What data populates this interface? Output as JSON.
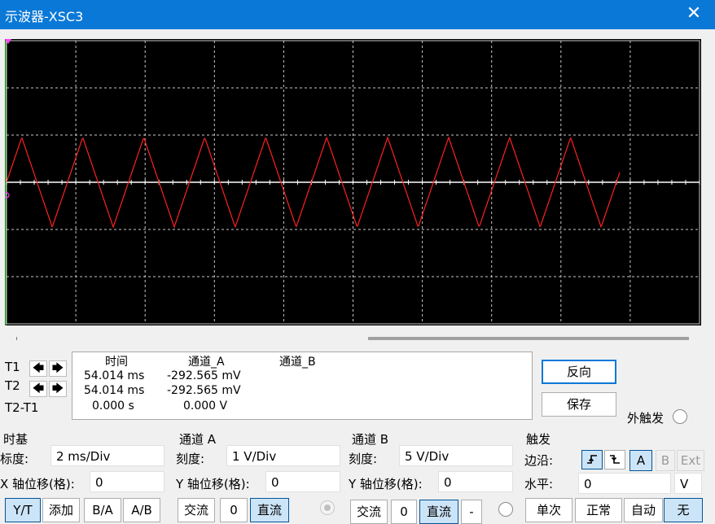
{
  "window": {
    "title": "示波器-XSC3",
    "close_icon": "close-icon"
  },
  "trace": {
    "color": "#ff2020",
    "axis_color": "#ffffff",
    "grid_color": "#c8c8c8",
    "cursor_t1_color": "#ff40ff",
    "cursor_t2_color": "#40ff40"
  },
  "cursors": {
    "t1_label": "T1",
    "t2_label": "T2",
    "diff_label": "T2-T1",
    "left_arrow": "🡄",
    "right_arrow": "🡆"
  },
  "readout": {
    "headers": {
      "time": "时间",
      "channel_a": "通道_A",
      "channel_b": "通道_B"
    },
    "rows": [
      {
        "time": "54.014 ms",
        "a": "-292.565 mV",
        "b": ""
      },
      {
        "time": "54.014 ms",
        "a": "-292.565 mV",
        "b": ""
      },
      {
        "time": "0.000 s",
        "a": "0.000 V",
        "b": ""
      }
    ]
  },
  "actions": {
    "reverse": "反向",
    "save": "保存",
    "ext_trigger": "外触发"
  },
  "timebase": {
    "section": "时基",
    "scale_label": "标度:",
    "scale_value": "2 ms/Div",
    "xpos_label": "X 轴位移(格):",
    "xpos_value": "0",
    "mode_buttons": [
      "Y/T",
      "添加",
      "B/A",
      "A/B"
    ],
    "active_mode": "Y/T"
  },
  "channel_a": {
    "section": "通道 A",
    "scale_label": "刻度:",
    "scale_value": "1  V/Div",
    "ypos_label": "Y 轴位移(格):",
    "ypos_value": "0",
    "coupling": [
      "交流",
      "0",
      "直流"
    ],
    "active_coupling": "直流"
  },
  "channel_b": {
    "section": "通道 B",
    "scale_label": "刻度:",
    "scale_value": "5  V/Div",
    "ypos_label": "Y 轴位移(格):",
    "ypos_value": "0",
    "coupling": [
      "交流",
      "0",
      "直流",
      "-"
    ],
    "active_coupling": "直流"
  },
  "trigger": {
    "section": "触发",
    "edge_label": "边沿:",
    "edge_rising_icon": "rising-edge-icon",
    "edge_falling_icon": "falling-edge-icon",
    "source_buttons": [
      "A",
      "B",
      "Ext"
    ],
    "active_source": "A",
    "level_label": "水平:",
    "level_value": "0",
    "level_unit": "V",
    "mode_buttons": [
      "单次",
      "正常",
      "自动",
      "无"
    ],
    "active_mode": "无"
  }
}
